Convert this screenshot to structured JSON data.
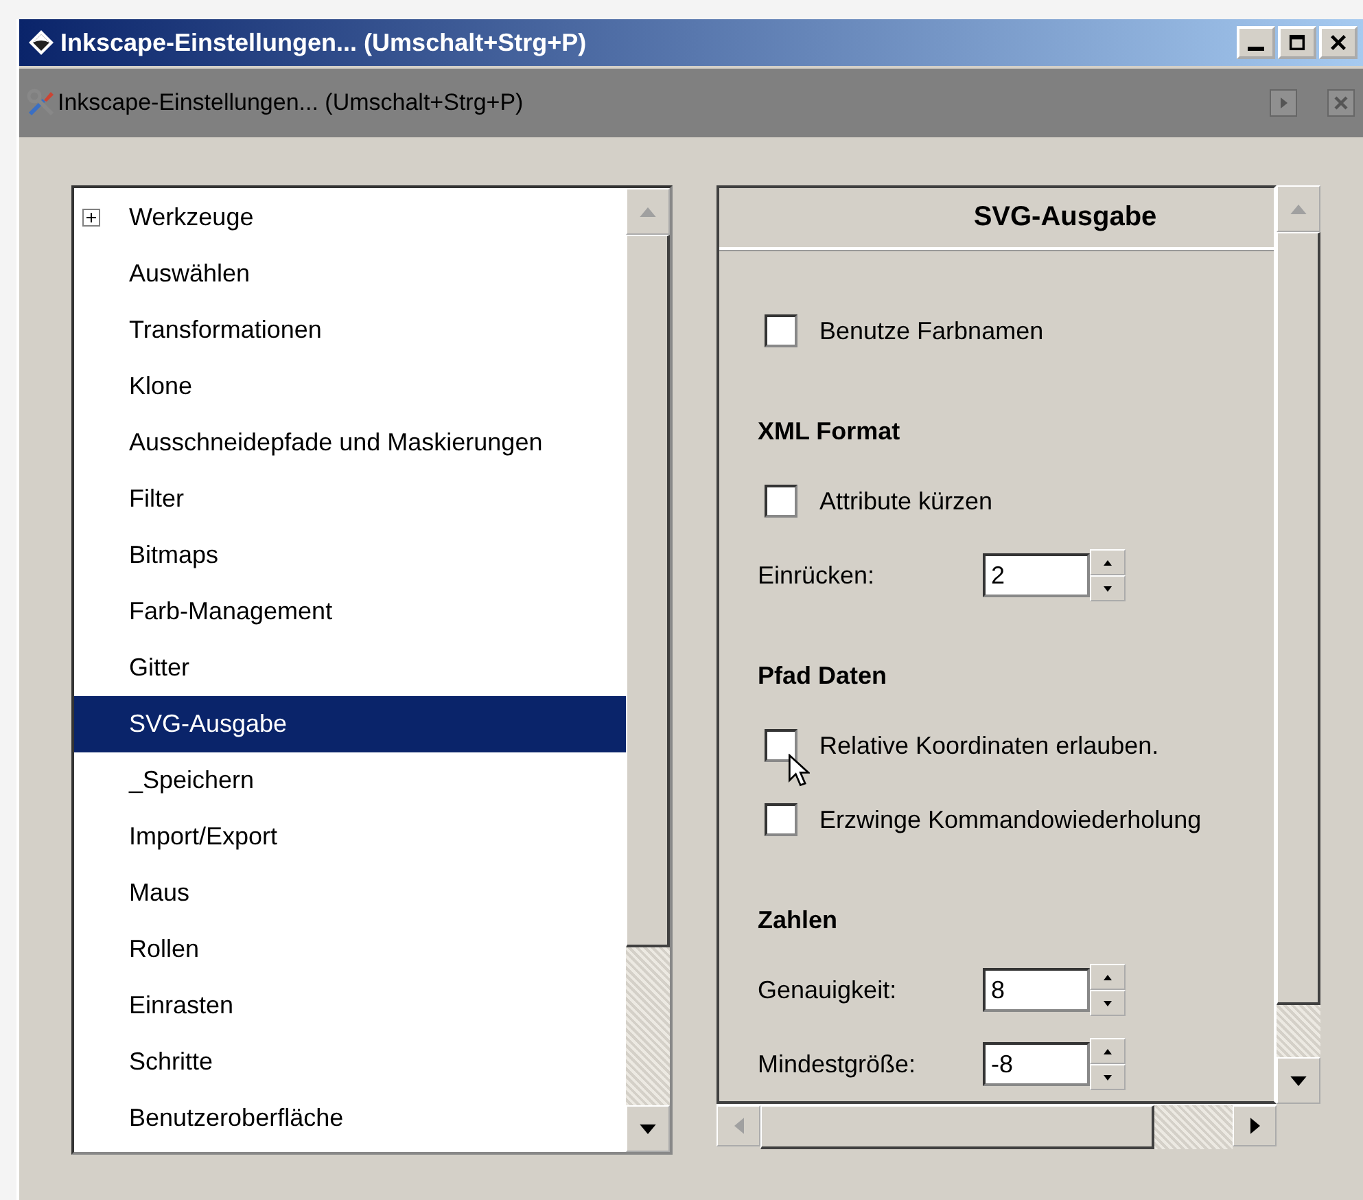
{
  "window": {
    "title": "Inkscape-Einstellungen... (Umschalt+Strg+P)",
    "buttons": [
      {
        "kind": "minimize"
      },
      {
        "kind": "maximize"
      },
      {
        "kind": "close"
      }
    ]
  },
  "dialog_header": {
    "title": "Inkscape-Einstellungen... (Umschalt+Strg+P)"
  },
  "sidebar": {
    "items": [
      {
        "label": "Werkzeuge",
        "selected": false,
        "kind": "group",
        "expanded": false
      },
      {
        "label": "Auswählen",
        "selected": false,
        "kind": "page"
      },
      {
        "label": "Transformationen",
        "selected": false,
        "kind": "page"
      },
      {
        "label": "Klone",
        "selected": false,
        "kind": "page"
      },
      {
        "label": "Ausschneidepfade und Maskierungen",
        "selected": false,
        "kind": "page"
      },
      {
        "label": "Filter",
        "selected": false,
        "kind": "page"
      },
      {
        "label": "Bitmaps",
        "selected": false,
        "kind": "page"
      },
      {
        "label": "Farb-Management",
        "selected": false,
        "kind": "page"
      },
      {
        "label": "Gitter",
        "selected": false,
        "kind": "page"
      },
      {
        "label": "SVG-Ausgabe",
        "selected": true,
        "kind": "page"
      },
      {
        "label": "_Speichern",
        "selected": false,
        "kind": "page"
      },
      {
        "label": "Import/Export",
        "selected": false,
        "kind": "page"
      },
      {
        "label": "Maus",
        "selected": false,
        "kind": "page"
      },
      {
        "label": "Rollen",
        "selected": false,
        "kind": "page"
      },
      {
        "label": "Einrasten",
        "selected": false,
        "kind": "page"
      },
      {
        "label": "Schritte",
        "selected": false,
        "kind": "page"
      },
      {
        "label": "Benutzeroberfläche",
        "selected": false,
        "kind": "page"
      }
    ]
  },
  "panel": {
    "title": "SVG-Ausgabe",
    "rows": [
      {
        "kind": "checkbox",
        "label": "Benutze Farbnamen",
        "checked": false
      },
      {
        "kind": "heading",
        "label": "XML Format"
      },
      {
        "kind": "checkbox",
        "label": "Attribute kürzen",
        "checked": false
      },
      {
        "kind": "spin",
        "label": "Einrücken:",
        "value": "2"
      },
      {
        "kind": "heading",
        "label": "Pfad Daten"
      },
      {
        "kind": "checkbox",
        "label": "Relative Koordinaten erlauben.",
        "checked": false,
        "hovered": true
      },
      {
        "kind": "checkbox",
        "label": "Erzwinge Kommandowiederholung",
        "checked": false
      },
      {
        "kind": "heading",
        "label": "Zahlen"
      },
      {
        "kind": "spin",
        "label": "Genauigkeit:",
        "value": "8"
      },
      {
        "kind": "spin",
        "label": "Mindestgröße:",
        "value": "-8"
      }
    ]
  }
}
